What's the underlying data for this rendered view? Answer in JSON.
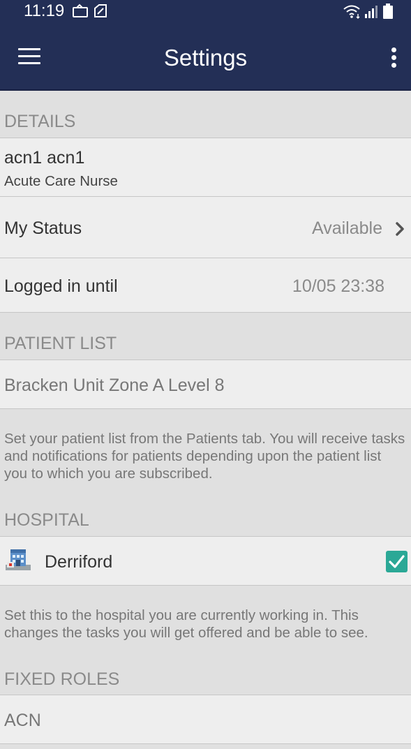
{
  "status_bar": {
    "time": "11:19",
    "icons_left": [
      "notification-icon",
      "nfc-icon"
    ],
    "icons_right": [
      "wifi-icon",
      "signal-icon",
      "battery-icon"
    ]
  },
  "app_bar": {
    "title": "Settings",
    "menu_icon": "hamburger-menu-icon",
    "more_icon": "more-vert-icon",
    "background": "#232f56"
  },
  "details": {
    "header": "DETAILS",
    "user_name": "acn1 acn1",
    "user_role": "Acute Care Nurse",
    "my_status_label": "My Status",
    "my_status_value": "Available",
    "logged_in_label": "Logged in until",
    "logged_in_value": "10/05 23:38"
  },
  "patient_list": {
    "header": "PATIENT LIST",
    "value": "Bracken Unit Zone A Level 8",
    "description": "Set your patient list from the Patients tab. You will receive tasks and notifications for patients depending upon the patient list you to which you are subscribed."
  },
  "hospital": {
    "header": "HOSPITAL",
    "name": "Derriford",
    "icon": "hospital-building-icon",
    "checked": true,
    "accent": "#2ba896",
    "description": "Set this to the hospital you are currently working in. This changes the tasks you will get offered and be able to see."
  },
  "fixed_roles": {
    "header": "FIXED ROLES",
    "role": "ACN"
  }
}
